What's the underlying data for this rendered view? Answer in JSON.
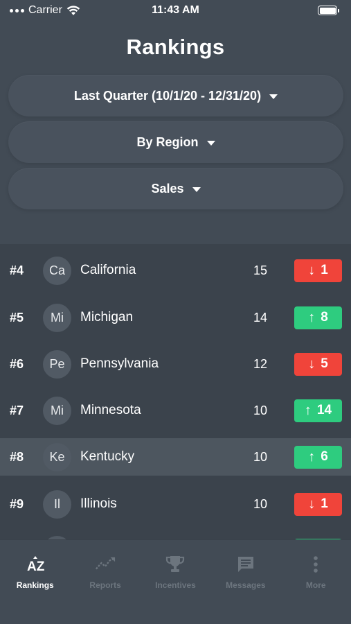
{
  "status_bar": {
    "carrier": "Carrier",
    "time": "11:43 AM"
  },
  "title": "Rankings",
  "filters": [
    {
      "label": "Last Quarter (10/1/20 - 12/31/20)"
    },
    {
      "label": "By Region"
    },
    {
      "label": "Sales"
    }
  ],
  "rankings": [
    {
      "rank": "#4",
      "initials": "Ca",
      "name": "California",
      "score": "15",
      "direction": "down",
      "arrow": "↓",
      "change": "1"
    },
    {
      "rank": "#5",
      "initials": "Mi",
      "name": "Michigan",
      "score": "14",
      "direction": "up",
      "arrow": "↑",
      "change": "8"
    },
    {
      "rank": "#6",
      "initials": "Pe",
      "name": "Pennsylvania",
      "score": "12",
      "direction": "down",
      "arrow": "↓",
      "change": "5"
    },
    {
      "rank": "#7",
      "initials": "Mi",
      "name": "Minnesota",
      "score": "10",
      "direction": "up",
      "arrow": "↑",
      "change": "14"
    },
    {
      "rank": "#8",
      "initials": "Ke",
      "name": "Kentucky",
      "score": "10",
      "direction": "up",
      "arrow": "↑",
      "change": "6"
    },
    {
      "rank": "#9",
      "initials": "Il",
      "name": "Illinois",
      "score": "10",
      "direction": "down",
      "arrow": "↓",
      "change": "1"
    }
  ],
  "tabs": [
    {
      "label": "Rankings",
      "icon": "az-sort-icon",
      "active": true
    },
    {
      "label": "Reports",
      "icon": "trend-chart-icon",
      "active": false
    },
    {
      "label": "Incentives",
      "icon": "trophy-icon",
      "active": false
    },
    {
      "label": "Messages",
      "icon": "message-icon",
      "active": false
    },
    {
      "label": "More",
      "icon": "more-vertical-icon",
      "active": false
    }
  ],
  "colors": {
    "background": "#424b55",
    "list_background": "#3b434c",
    "highlight_row": "#4d565f",
    "up": "#2ecc7f",
    "down": "#f0443a",
    "inactive_tab": "#6c757e"
  }
}
